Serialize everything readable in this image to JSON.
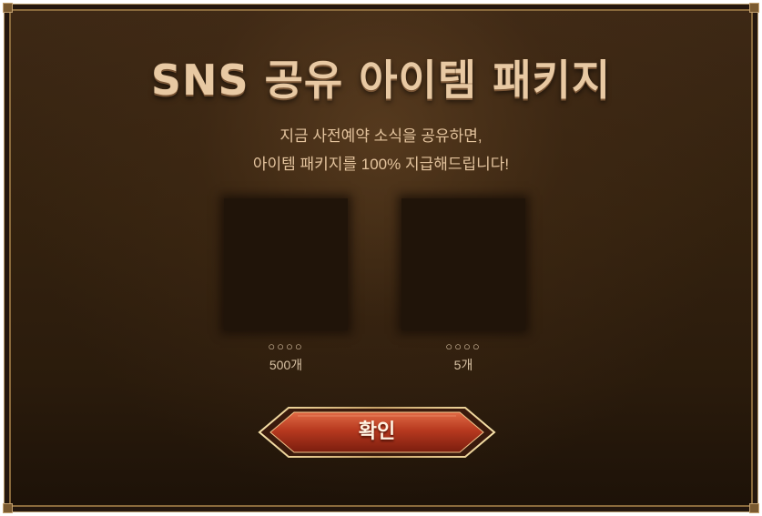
{
  "dialog": {
    "title": "SNS 공유 아이템 패키지",
    "subtitle_line1": "지금 사전예약 소식을 공유하면,",
    "subtitle_line2": "아이템 패키지를 100% 지급해드립니다!",
    "items": [
      {
        "name": "○○○○",
        "quantity": "500개"
      },
      {
        "name": "○○○○",
        "quantity": "5개"
      }
    ],
    "confirm_label": "확인"
  },
  "colors": {
    "background": "#2e1e0f",
    "title": "#e8c9a3",
    "text": "#e3c39d",
    "button": "#c2452a",
    "gold_border": "#c9a46a"
  }
}
